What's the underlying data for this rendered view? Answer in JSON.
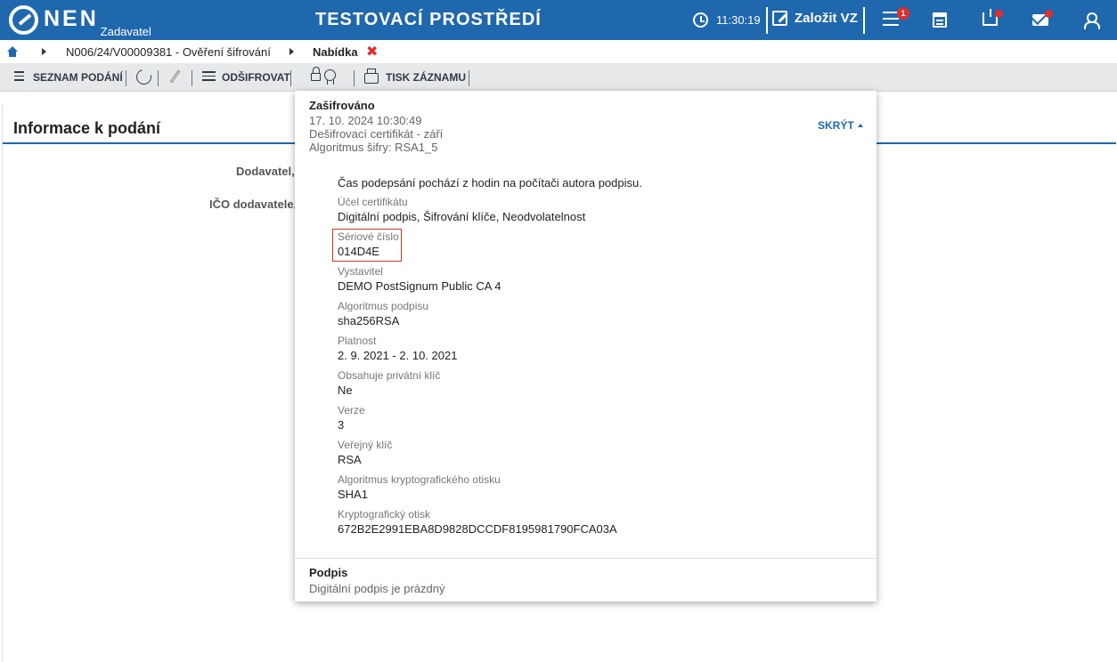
{
  "header": {
    "logo_text": "NEN",
    "logo_sub": "Zadavatel",
    "env_title": "TESTOVACÍ PROSTŘEDÍ",
    "clock_time": "11:30:19",
    "create_label": "Založit VZ",
    "menu_badge": "1",
    "brand_color": "#1f68ad",
    "alert_color": "#e42d2d"
  },
  "breadcrumb": {
    "item1": "N006/24/V00009381 - Ověření šifrování",
    "current": "Nabídka",
    "close_glyph": "✖"
  },
  "toolbar": {
    "list_label": "SEZNAM PODÁNÍ",
    "decrypt_label": "ODŠIFROVAT",
    "print_label": "TISK ZÁZNAMU"
  },
  "main": {
    "title": "Informace k podání",
    "label1": "Dodavatel, I",
    "label2": "IČO dodavatele, I"
  },
  "popup": {
    "status_title": "Zašifrováno",
    "date": "17. 10. 2024 10:30:49",
    "cert": "Dešifrovací certifikát - září",
    "algo": "Algoritmus šifry: RSA1_5",
    "hide_label": "SKRÝT",
    "note": "Čas podepsání pochází z hodin na počítači autora podpisu.",
    "details": [
      {
        "label": "Účel certifikátu",
        "value": "Digitální podpis, Šifrování klíče, Neodvolatelnost"
      },
      {
        "label": "Sériové číslo",
        "value": "014D4E"
      },
      {
        "label": "Vystavitel",
        "value": "DEMO PostSignum Public CA 4"
      },
      {
        "label": "Algoritmus podpisu",
        "value": "sha256RSA"
      },
      {
        "label": "Platnost",
        "value": "2. 9. 2021 - 2. 10. 2021"
      },
      {
        "label": "Obsahuje privátní klíč",
        "value": "Ne"
      },
      {
        "label": "Verze",
        "value": "3"
      },
      {
        "label": "Veřejný klíč",
        "value": "RSA"
      },
      {
        "label": "Algoritmus kryptografického otisku",
        "value": "SHA1"
      },
      {
        "label": "Kryptografický otisk",
        "value": "672B2E2991EBA8D9828DCCDF8195981790FCA03A"
      }
    ],
    "signature_title": "Podpis",
    "signature_value": "Digitální podpis je prázdný"
  }
}
